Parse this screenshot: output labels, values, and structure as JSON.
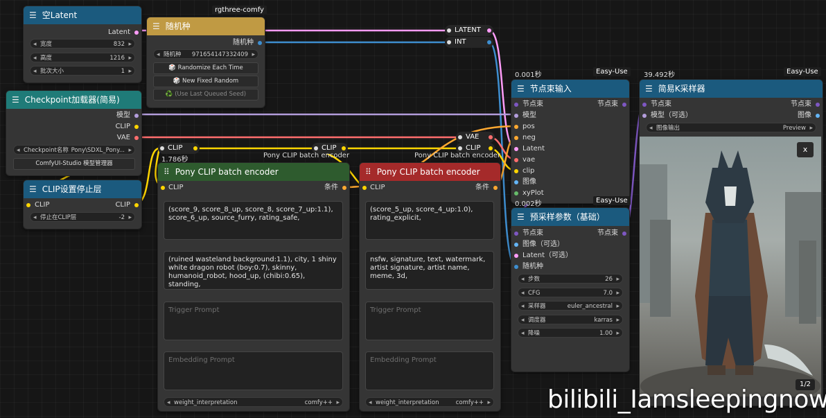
{
  "empty_latent": {
    "title": "空Latent",
    "output": "Latent",
    "width_label": "宽度",
    "width_value": "832",
    "height_label": "高度",
    "height_value": "1216",
    "batch_label": "批次大小",
    "batch_value": "1"
  },
  "seed_node": {
    "group_tag": "rgthree-comfy",
    "title": "随机种",
    "output": "随机种",
    "seed_label": "随机种",
    "seed_value": "971654147332409",
    "randomize_label": "🎲 Randomize Each Time",
    "fixed_label": "🎲 New Fixed Random",
    "last_label": "♻️ (Use Last Queued Seed)"
  },
  "reroute_top": {
    "latent": "LATENT",
    "int": "INT"
  },
  "checkpoint": {
    "title": "Checkpoint加载器(简易)",
    "out_model": "模型",
    "out_clip": "CLIP",
    "out_vae": "VAE",
    "ckpt_label": "Checkpoint名称",
    "ckpt_value": "Pony\\SDXL_Pony...",
    "manager_label": "ComfyUI-Studio 模型管理器"
  },
  "clip_stop": {
    "title": "CLIP设置停止层",
    "in_clip": "CLIP",
    "out_clip": "CLIP",
    "layer_label": "停止在CLIP层",
    "layer_value": "-2"
  },
  "reroute_mid": {
    "clip_left": "CLIP",
    "clip_mid": "CLIP",
    "vae": "VAE",
    "clip_right": "CLIP"
  },
  "timing": {
    "pos_encoder": "1.786秒",
    "pipe_in": "0.001秒",
    "sampler": "39.492秒",
    "settings": "0.002秒"
  },
  "float_titles": {
    "pony1": "Pony CLIP batch encoder",
    "pony2": "Pony CLIP batch encoder"
  },
  "pos_encoder": {
    "title": "Pony CLIP batch encoder",
    "in_clip": "CLIP",
    "out": "条件",
    "text1": "(score_9, score_8_up, score_8, score_7_up:1.1), score_6_up, source_furry, rating_safe,",
    "text2": "(ruined wasteland background:1.1), city, 1 shiny white dragon robot (boy:0.7), skinny, humanoid_robot, hood_up, (chibi:0.65), standing,",
    "trigger_placeholder": "Trigger Prompt",
    "embedding_placeholder": "Embedding Prompt",
    "weight_label": "weight_interpretation",
    "weight_value": "comfy++"
  },
  "neg_encoder": {
    "title": "Pony CLIP batch encoder",
    "in_clip": "CLIP",
    "out": "条件",
    "text1": "(score_5_up, score_4_up:1.0), rating_explicit,",
    "text2": "nsfw, signature, text, watermark, artist signature, artist name, meme, 3d,",
    "trigger_placeholder": "Trigger Prompt",
    "embedding_placeholder": "Embedding Prompt",
    "weight_label": "weight_interpretation",
    "weight_value": "comfy++"
  },
  "pipe_in": {
    "tag": "Easy-Use",
    "title": "节点束输入",
    "in_pipe": "节点束",
    "out_pipe": "节点束",
    "inputs": [
      "模型",
      "pos",
      "neg",
      "Latent",
      "vae",
      "clip",
      "图像",
      "xyPlot"
    ]
  },
  "settings": {
    "tag": "Easy-Use",
    "title": "预采样参数（基础）",
    "in_pipe": "节点束",
    "out_pipe": "节点束",
    "in_image": "图像（可选）",
    "in_latent": "Latent（可选）",
    "in_seed": "随机种",
    "steps_label": "步数",
    "steps_value": "26",
    "cfg_label": "CFG",
    "cfg_value": "7.0",
    "sampler_label": "采样器",
    "sampler_value": "euler_ancestral",
    "scheduler_label": "调度器",
    "scheduler_value": "karras",
    "denoise_label": "降噪",
    "denoise_value": "1.00"
  },
  "sampler": {
    "tag": "Easy-Use",
    "title": "简易K采样器",
    "in_pipe": "节点束",
    "in_model": "模型（可选）",
    "out_pipe": "节点束",
    "out_image": "图像",
    "output_label": "图像输出",
    "output_value": "Preview",
    "close_label": "x",
    "page_label": "1/2"
  },
  "watermark": "bilibili_Iamsleepingnow",
  "colors": {
    "wire_latent": "#ff9cf9",
    "wire_int": "#3e8ed0",
    "wire_model": "#b39ddb",
    "wire_clip": "#ffd500",
    "wire_vae": "#ff6e6e",
    "wire_pipe": "#7e57c2",
    "wire_cond": "#ffa931"
  }
}
